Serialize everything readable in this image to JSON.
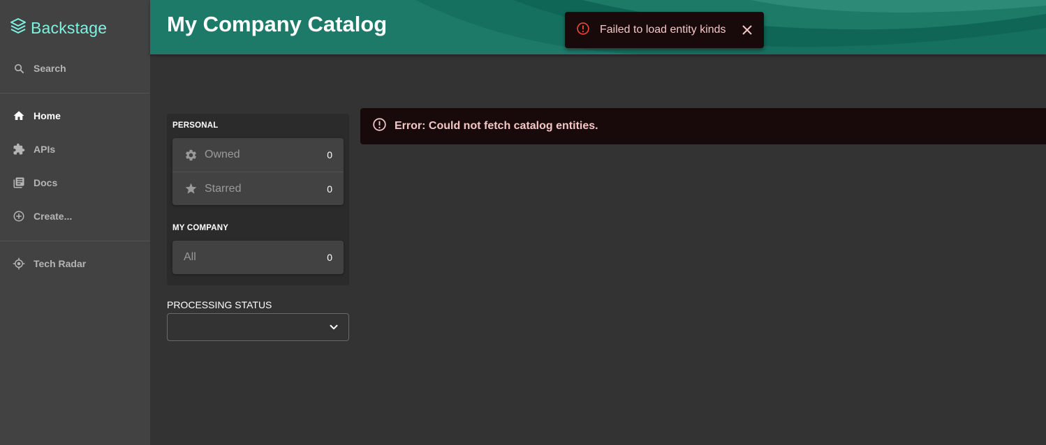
{
  "sidebar": {
    "logo_text": "Backstage",
    "search_label": "Search",
    "items": [
      {
        "label": "Home",
        "icon": "home-icon"
      },
      {
        "label": "APIs",
        "icon": "puzzle-icon"
      },
      {
        "label": "Docs",
        "icon": "library-books-icon"
      },
      {
        "label": "Create...",
        "icon": "add-circle-icon"
      },
      {
        "label": "Tech Radar",
        "icon": "radar-icon"
      }
    ]
  },
  "header": {
    "title": "My Company Catalog"
  },
  "snackbar": {
    "message": "Failed to load entity kinds"
  },
  "filters": {
    "personal_label": "PERSONAL",
    "owned_label": "Owned",
    "owned_count": "0",
    "starred_label": "Starred",
    "starred_count": "0",
    "company_label": "MY COMPANY",
    "all_label": "All",
    "all_count": "0"
  },
  "processing_status": {
    "label": "PROCESSING STATUS",
    "selected": ""
  },
  "error": {
    "message": "Error: Could not fetch catalog entities."
  },
  "colors": {
    "accent": "#7df3e1",
    "header": "#1b7968",
    "error_bg": "#180a0a",
    "error_text": "#f4c7c7",
    "error_icon": "#f44336"
  }
}
